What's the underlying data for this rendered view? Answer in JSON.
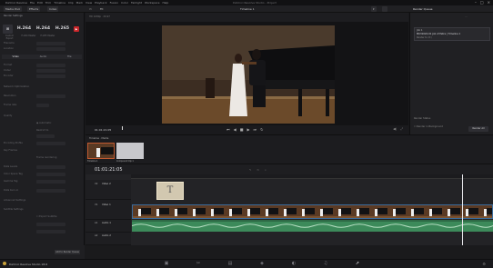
{
  "window": {
    "title": "DaVinci Resolve Studio - Project",
    "controls": [
      "–",
      "□",
      "×"
    ]
  },
  "menu": [
    "DaVinci Resolve",
    "File",
    "Edit",
    "Trim",
    "Timeline",
    "Clip",
    "Mark",
    "View",
    "Playback",
    "Fusion",
    "Color",
    "Fairlight",
    "Workspace",
    "Help"
  ],
  "toolbar": {
    "btn1": "Media Pool",
    "btn2": "Effects",
    "btn3": "Index",
    "timeline_name": "Timeline 1",
    "right_btn": "Render Queue"
  },
  "left_panel": {
    "codecs": [
      "H.264",
      "H.264",
      "H.265"
    ],
    "codec_labels": [
      "Custom Export",
      "H.264 Master",
      "H.265 Master"
    ],
    "tabs": [
      "Video",
      "Audio",
      "File"
    ],
    "rows": [
      "Format",
      "Codec",
      "Encoder",
      "Network Optimization",
      "Resolution",
      "Frame rate",
      "Quality",
      "Restrict to",
      "Encoding Profile",
      "Key Frames",
      "Frame reordering",
      "Data Levels",
      "Color Space Tag",
      "Gamma Tag",
      "Data burn-in",
      "Advanced Settings",
      "Subtitle Settings"
    ]
  },
  "viewer": {
    "timecode": "01:01:21:05",
    "clip_label": "Timeline 1"
  },
  "right_panel": {
    "title": "Render Queue",
    "job_title": "Job 1",
    "job_name": "MK31024-01 Job of Petra | Timeline 1",
    "job_sub": "Render to: D:\\",
    "render_all": "Render All"
  },
  "mediapool": {
    "clips": [
      "Timeline 1",
      "Compound Clip 1"
    ]
  },
  "timeline": {
    "timecode": "01:01:21:05",
    "tracks": [
      {
        "id": "V2",
        "name": "Video 2"
      },
      {
        "id": "V1",
        "name": "Video 1"
      },
      {
        "id": "A1",
        "name": "Audio 1"
      },
      {
        "id": "A2",
        "name": "Audio 2"
      }
    ],
    "text_clip": "T"
  },
  "bottom": {
    "app_name": "DaVinci Resolve Studio 18.6",
    "pages": [
      "media",
      "cut",
      "edit",
      "fusion",
      "color",
      "fairlight",
      "deliver"
    ],
    "active_page": "deliver"
  }
}
